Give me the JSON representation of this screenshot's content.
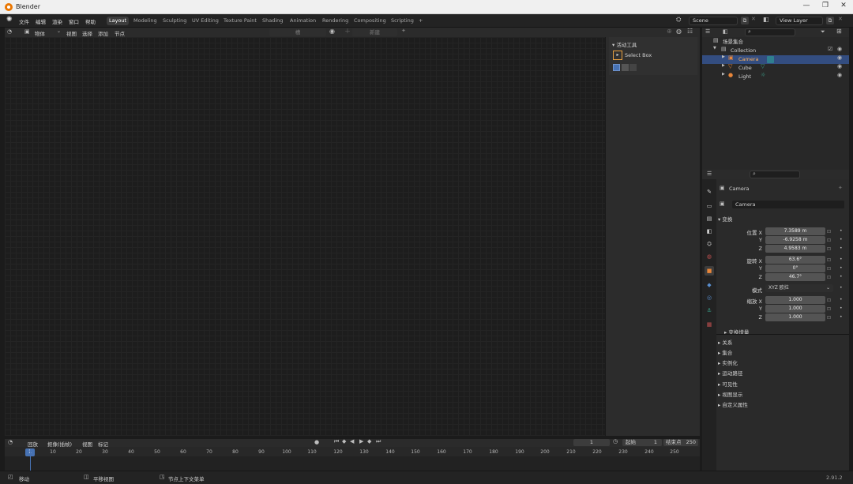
{
  "window": {
    "title": "Blender",
    "minimize": "—",
    "restore": "❐",
    "close": "✕"
  },
  "menus": [
    "文件",
    "编辑",
    "渲染",
    "窗口",
    "帮助"
  ],
  "workspaces": [
    "Layout",
    "Modeling",
    "Sculpting",
    "UV Editing",
    "Texture Paint",
    "Shading",
    "Animation",
    "Rendering",
    "Compositing",
    "Scripting"
  ],
  "add_tab": "+",
  "scene": {
    "label": "Scene",
    "view_layer": "View Layer"
  },
  "editor_header": {
    "object_label": "物体",
    "menus": [
      "视图",
      "选择",
      "添加",
      "节点"
    ],
    "slot": "槽",
    "new_button": "新建"
  },
  "npanel": {
    "section": "活动工具",
    "tool": "Select Box"
  },
  "timeline": {
    "playback": "回放",
    "keying": "抠像(插帧)",
    "view": "视图",
    "marker": "标记",
    "current_frame": "1",
    "start_label": "起始",
    "start": "1",
    "end_label": "结束点",
    "end": "250",
    "ticks": [
      "1",
      "10",
      "20",
      "30",
      "40",
      "50",
      "60",
      "70",
      "80",
      "90",
      "100",
      "110",
      "120",
      "130",
      "140",
      "150",
      "160",
      "170",
      "180",
      "190",
      "200",
      "210",
      "220",
      "230",
      "240",
      "250"
    ]
  },
  "statusbar": {
    "item1": "移动",
    "item2": "平移视图",
    "item3": "节点上下文菜单",
    "version": "2.91.2"
  },
  "outliner": {
    "root": "场景集合",
    "collection": "Collection",
    "items": [
      {
        "name": "Camera",
        "selected": true
      },
      {
        "name": "Cube",
        "selected": false
      },
      {
        "name": "Light",
        "selected": false
      }
    ]
  },
  "properties": {
    "object_name": "Camera",
    "datablock_name": "Camera",
    "transform_title": "变换",
    "location_label": "位置 X",
    "location": [
      "7.3589 m",
      "-6.9258 m",
      "4.9583 m"
    ],
    "rotation_label": "旋转 X",
    "rotation": [
      "63.6°",
      "0°",
      "46.7°"
    ],
    "mode_label": "模式",
    "mode_value": "XYZ 欧拉",
    "scale_label": "缩放 X",
    "scale": [
      "1.000",
      "1.000",
      "1.000"
    ],
    "axis_y": "Y",
    "axis_z": "Z",
    "delta_transform": "变换增量",
    "sections": [
      "关系",
      "集合",
      "实例化",
      "运动路径",
      "可见性",
      "视图显示",
      "自定义属性"
    ]
  },
  "colors": {
    "accent_blue": "#4772b3",
    "selection": "#334d80",
    "camera_orange": "#e8863a"
  }
}
